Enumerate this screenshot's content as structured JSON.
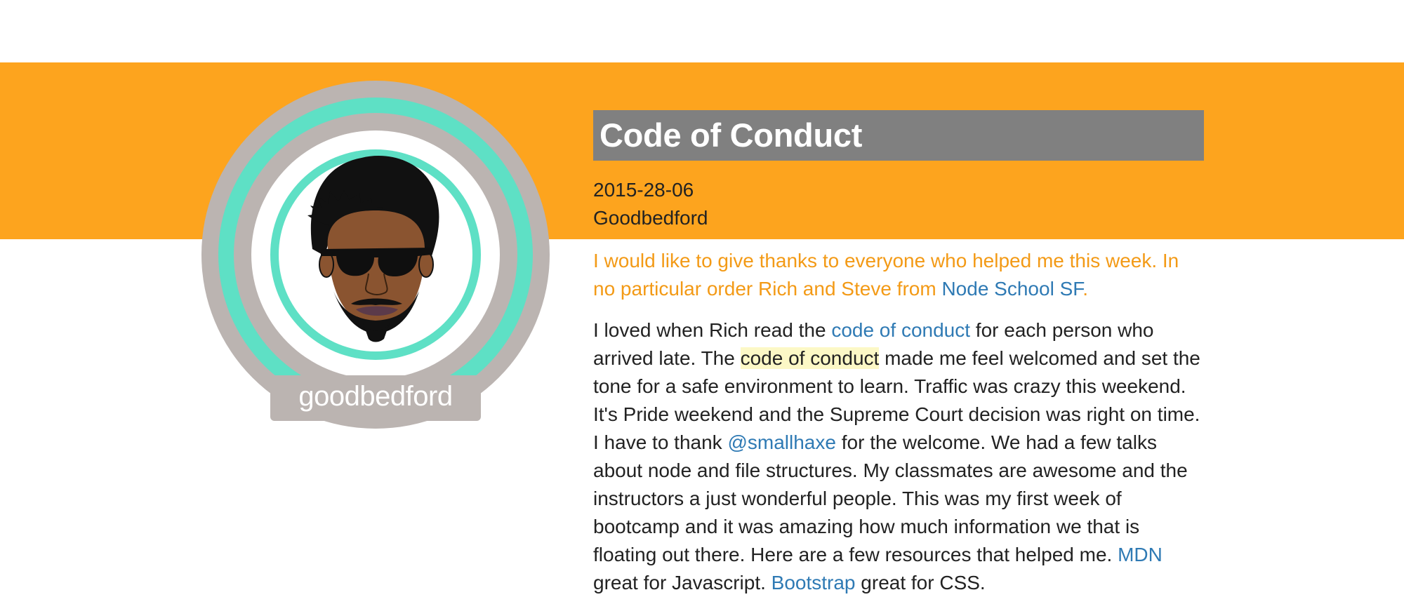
{
  "post": {
    "title": "Code of Conduct",
    "date": "2015-28-06",
    "author": "Goodbedford"
  },
  "avatar": {
    "username": "goodbedford"
  },
  "thanks": {
    "text_before": "I would like to give thanks to everyone who helped me this week. In no particular order Rich and Steve from ",
    "link_text": "Node School SF",
    "text_after": "."
  },
  "story": {
    "t1": "I loved when Rich read the ",
    "link_code_of_conduct": "code of conduct",
    "t2": " for each person who arrived late. The ",
    "highlight": "code of conduct",
    "t3": " made me feel welcomed and set the tone for a safe environment to learn. Traffic was crazy this weekend. It's Pride weekend and the Supreme Court decision was right on time. I have to thank ",
    "link_smallhaxe": "@smallhaxe",
    "t4": " for the welcome. We had a few talks about node and file structures. My classmates are awesome and the instructors a just wonderful people. This was my first week of bootcamp and it was amazing how much information we that is floating out there. Here are a few resources that helped me. ",
    "link_mdn": "MDN",
    "t5": " great for Javascript. ",
    "link_bootstrap": "Bootstrap",
    "t6": " great for CSS."
  },
  "colors": {
    "banner": "#fda41e",
    "title_bg": "#808080",
    "ring_outer": "#bbb4b1",
    "ring_teal": "#5ee0c5",
    "link": "#2f7ab4",
    "thanks_text": "#f39a16",
    "highlight": "#fcf8c6"
  }
}
